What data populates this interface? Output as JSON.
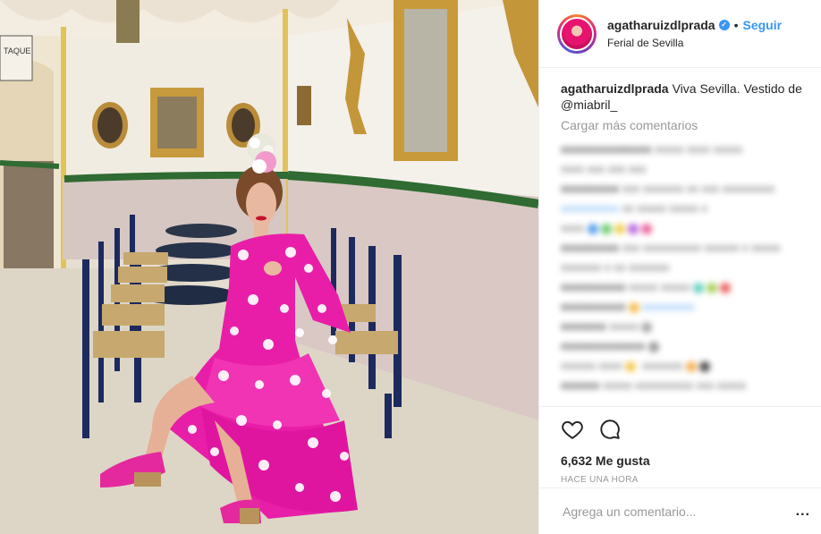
{
  "header": {
    "username": "agatharuizdlprada",
    "verified_symbol": "✓",
    "separator": "•",
    "follow_label": "Seguir",
    "location": "Ferial de Sevilla"
  },
  "caption": {
    "username": "agatharuizdlprada",
    "text": "Viva Sevilla. Vestido de @miabril_"
  },
  "load_more_label": "Cargar más comentarios",
  "actions": {
    "likes": "6,632 Me gusta",
    "timestamp": "HACE UNA HORA",
    "like_icon": "heart-icon",
    "comment_icon": "comment-icon"
  },
  "comment_box": {
    "placeholder": "Agrega un comentario...",
    "more_label": "..."
  },
  "media": {
    "sign_text": "TAQUE\nANA",
    "alt": "Mujer con traje de flamenca rosa con lunares blancos sentada en una caseta de feria"
  },
  "colors": {
    "accent": "#3897f0",
    "dress": "#e91ea8",
    "muted": "#999999"
  }
}
